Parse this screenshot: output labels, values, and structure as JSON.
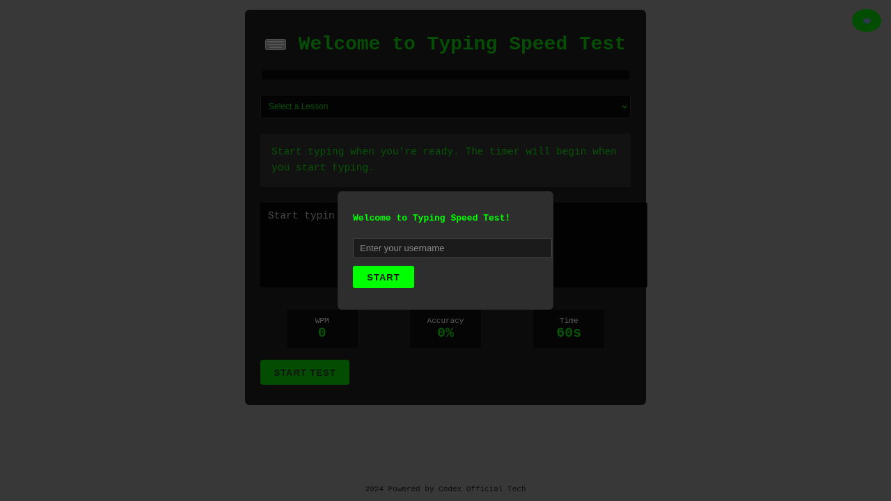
{
  "title": "Welcome to Typing Speed Test",
  "progress": {
    "level": 0
  },
  "lesson_select": {
    "placeholder": "Select a Lesson"
  },
  "prompt_text": "Start typing when you're ready. The timer will begin when you start typing.",
  "typing_area": {
    "placeholder": "Start typin"
  },
  "stats": [
    {
      "label": "WPM",
      "value": "0"
    },
    {
      "label": "Accuracy",
      "value": "0%"
    },
    {
      "label": "Time",
      "value": "60s"
    }
  ],
  "start_test_button": "START TEST",
  "footer": "2024 Powered by Codex Official Tech",
  "modal": {
    "title": "Welcome to Typing Speed Test!",
    "username_placeholder": "Enter your username",
    "start_button": "START"
  }
}
